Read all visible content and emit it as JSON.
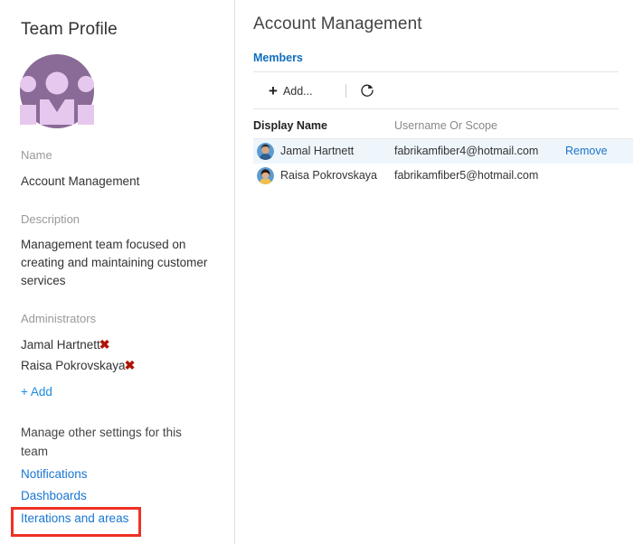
{
  "sidebar": {
    "title": "Team Profile",
    "avatar_icon": "team-avatar-icon",
    "fields": {
      "name_label": "Name",
      "name_value": "Account Management",
      "description_label": "Description",
      "description_value": "Management team focused on creating and maintaining customer services",
      "administrators_label": "Administrators"
    },
    "administrators": [
      {
        "name": "Jamal Hartnett",
        "remove_icon": "remove-x-icon"
      },
      {
        "name": "Raisa Pokrovskaya",
        "remove_icon": "remove-x-icon"
      }
    ],
    "add_admin_label": "+ Add",
    "manage_text": "Manage other settings for this team",
    "settings_links": [
      {
        "label": "Notifications",
        "name": "notifications"
      },
      {
        "label": "Dashboards",
        "name": "dashboards"
      },
      {
        "label": "Iterations and areas",
        "name": "iterations-and-areas"
      }
    ],
    "highlighted_link": "Iterations and areas"
  },
  "main": {
    "title": "Account Management",
    "tabs": [
      {
        "label": "Members",
        "selected": true
      }
    ],
    "toolbar": {
      "add_label": "Add...",
      "add_icon": "plus-icon",
      "refresh_icon": "refresh-icon"
    },
    "table": {
      "columns": [
        "Display Name",
        "Username Or Scope"
      ],
      "rows": [
        {
          "avatar": "user-avatar-icon",
          "display_name": "Jamal Hartnett",
          "username": "fabrikamfiber4@hotmail.com",
          "action_label": "Remove",
          "selected": true
        },
        {
          "avatar": "user-avatar-icon",
          "display_name": "Raisa Pokrovskaya",
          "username": "fabrikamfiber5@hotmail.com",
          "action_label": "",
          "selected": false
        }
      ]
    }
  },
  "colors": {
    "link_blue": "#1976d2",
    "tab_blue": "#106ebe",
    "annotation_red": "#ee3124",
    "remove_x_red": "#b01408",
    "selected_row": "#eef6fc",
    "avatar_purple": "#7e5f8c",
    "avatar_light": "#e6c8ee"
  },
  "annotation": {
    "type": "rectangle",
    "target": "Iterations and areas",
    "color": "#ee3124"
  }
}
